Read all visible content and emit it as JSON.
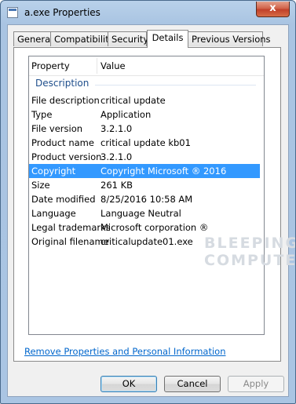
{
  "window": {
    "title": "a.exe Properties",
    "close_glyph": "x"
  },
  "tabs": [
    "General",
    "Compatibility",
    "Security",
    "Details",
    "Previous Versions"
  ],
  "active_tab": "Details",
  "list": {
    "columns": [
      "Property",
      "Value"
    ],
    "group_label": "Description",
    "rows": [
      {
        "property": "File description",
        "value": "critical update"
      },
      {
        "property": "Type",
        "value": "Application"
      },
      {
        "property": "File version",
        "value": "3.2.1.0"
      },
      {
        "property": "Product name",
        "value": "critical update kb01"
      },
      {
        "property": "Product version",
        "value": "3.2.1.0"
      },
      {
        "property": "Copyright",
        "value": "Copyright Microsoft ® 2016"
      },
      {
        "property": "Size",
        "value": "261 KB"
      },
      {
        "property": "Date modified",
        "value": "8/25/2016 10:58 AM"
      },
      {
        "property": "Language",
        "value": "Language Neutral"
      },
      {
        "property": "Legal trademarks",
        "value": "Microsoft  corporation ®"
      },
      {
        "property": "Original filename",
        "value": "criticalupdate01.exe"
      }
    ],
    "selected_row": "Copyright"
  },
  "link_remove": "Remove Properties and Personal Information",
  "buttons": {
    "ok": "OK",
    "cancel": "Cancel",
    "apply": "Apply"
  },
  "watermark": [
    "BLEEPING",
    "COMPUTER"
  ],
  "colors": {
    "selection": "#3399ff",
    "link": "#0066cc",
    "group_header": "#1e4e8c",
    "close_button": "#c1402a"
  }
}
